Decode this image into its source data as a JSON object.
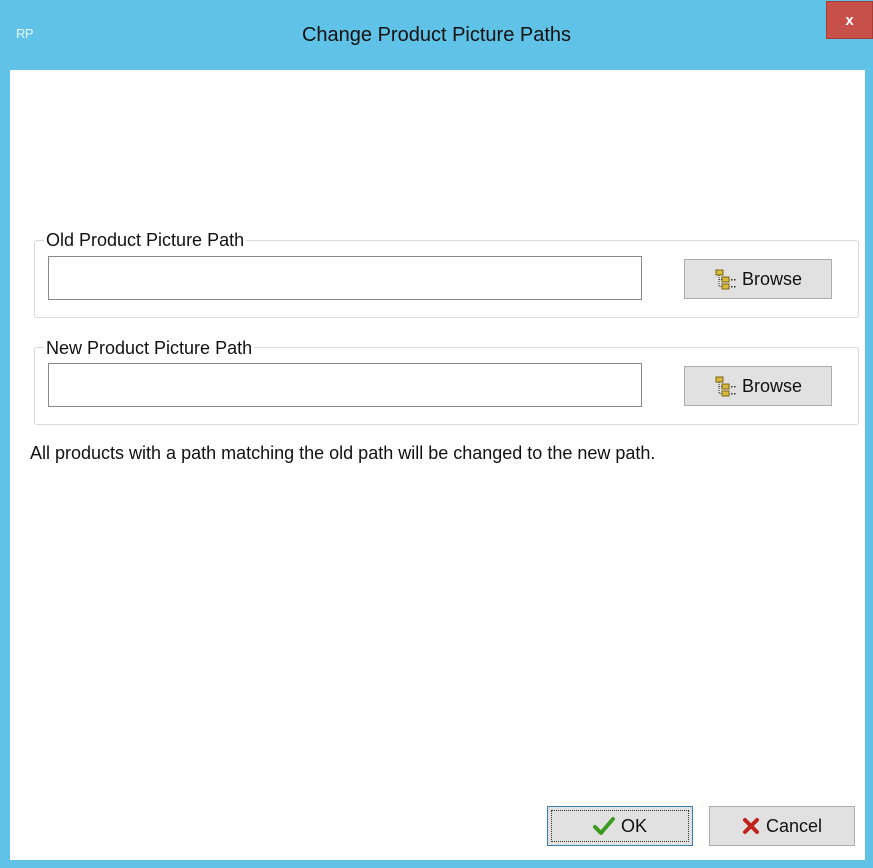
{
  "window": {
    "logo_text": "RP",
    "title": "Change Product Picture Paths",
    "close_label": "x"
  },
  "old_path": {
    "legend": "Old Product Picture Path",
    "value": "",
    "browse_label": "Browse"
  },
  "new_path": {
    "legend": "New Product Picture Path",
    "value": "",
    "browse_label": "Browse"
  },
  "note": "All products with a path matching the old path will be changed to the new path.",
  "footer": {
    "ok_label": "OK",
    "cancel_label": "Cancel"
  },
  "colors": {
    "titlebar": "#5fc2e6",
    "close_button": "#c7504b",
    "ok_check": "#3a9a1e",
    "cancel_x": "#c0231b",
    "folder_icon": "#d8b93a"
  },
  "icons": {
    "browse": "folder-tree-icon",
    "ok": "checkmark-icon",
    "cancel": "x-mark-icon"
  }
}
